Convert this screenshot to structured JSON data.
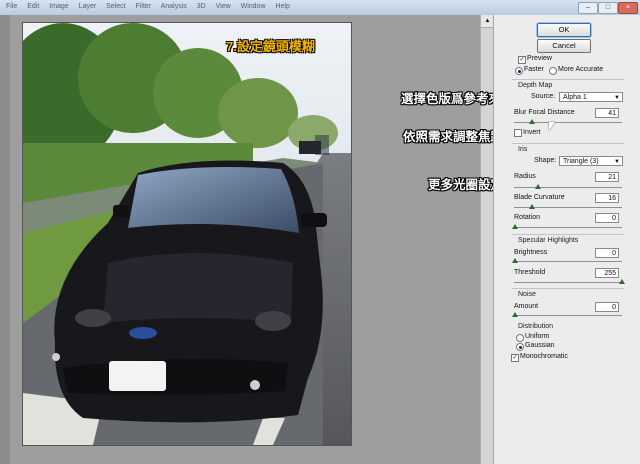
{
  "window": {
    "menu_items": [
      "File",
      "Edit",
      "Image",
      "Layer",
      "Select",
      "Filter",
      "Analysis",
      "3D",
      "View",
      "Window",
      "Help"
    ],
    "min_label": "–",
    "max_label": "□",
    "close_label": "×"
  },
  "photo": {
    "title": "7.設定鏡頭模糊"
  },
  "annotations": {
    "depth_source": "選擇色版爲參考來源",
    "focal": "依照需求調整焦距",
    "iris": "更多光圈設定"
  },
  "panel": {
    "ok_label": "OK",
    "cancel_label": "Cancel",
    "preview_label": "Preview",
    "preview_checked": true,
    "faster_label": "Faster",
    "more_accurate_label": "More Accurate",
    "depth_map": {
      "group_label": "Depth Map",
      "source_label": "Source:",
      "source_value": "Alpha 1",
      "blur_focal_label": "Blur Focal Distance",
      "blur_focal_value": "41",
      "invert_label": "Invert"
    },
    "iris": {
      "group_label": "Iris",
      "shape_label": "Shape:",
      "shape_value": "Triangle (3)",
      "radius_label": "Radius",
      "radius_value": "21",
      "blade_label": "Blade Curvature",
      "blade_value": "16",
      "rotation_label": "Rotation",
      "rotation_value": "0"
    },
    "specular": {
      "group_label": "Specular Highlights",
      "brightness_label": "Brightness",
      "brightness_value": "0",
      "threshold_label": "Threshold",
      "threshold_value": "255"
    },
    "noise": {
      "group_label": "Noise",
      "amount_label": "Amount",
      "amount_value": "0",
      "distribution_label": "Distribution",
      "uniform_label": "Uniform",
      "gaussian_label": "Gaussian",
      "monochromatic_label": "Monochromatic",
      "monochromatic_checked": true
    }
  }
}
